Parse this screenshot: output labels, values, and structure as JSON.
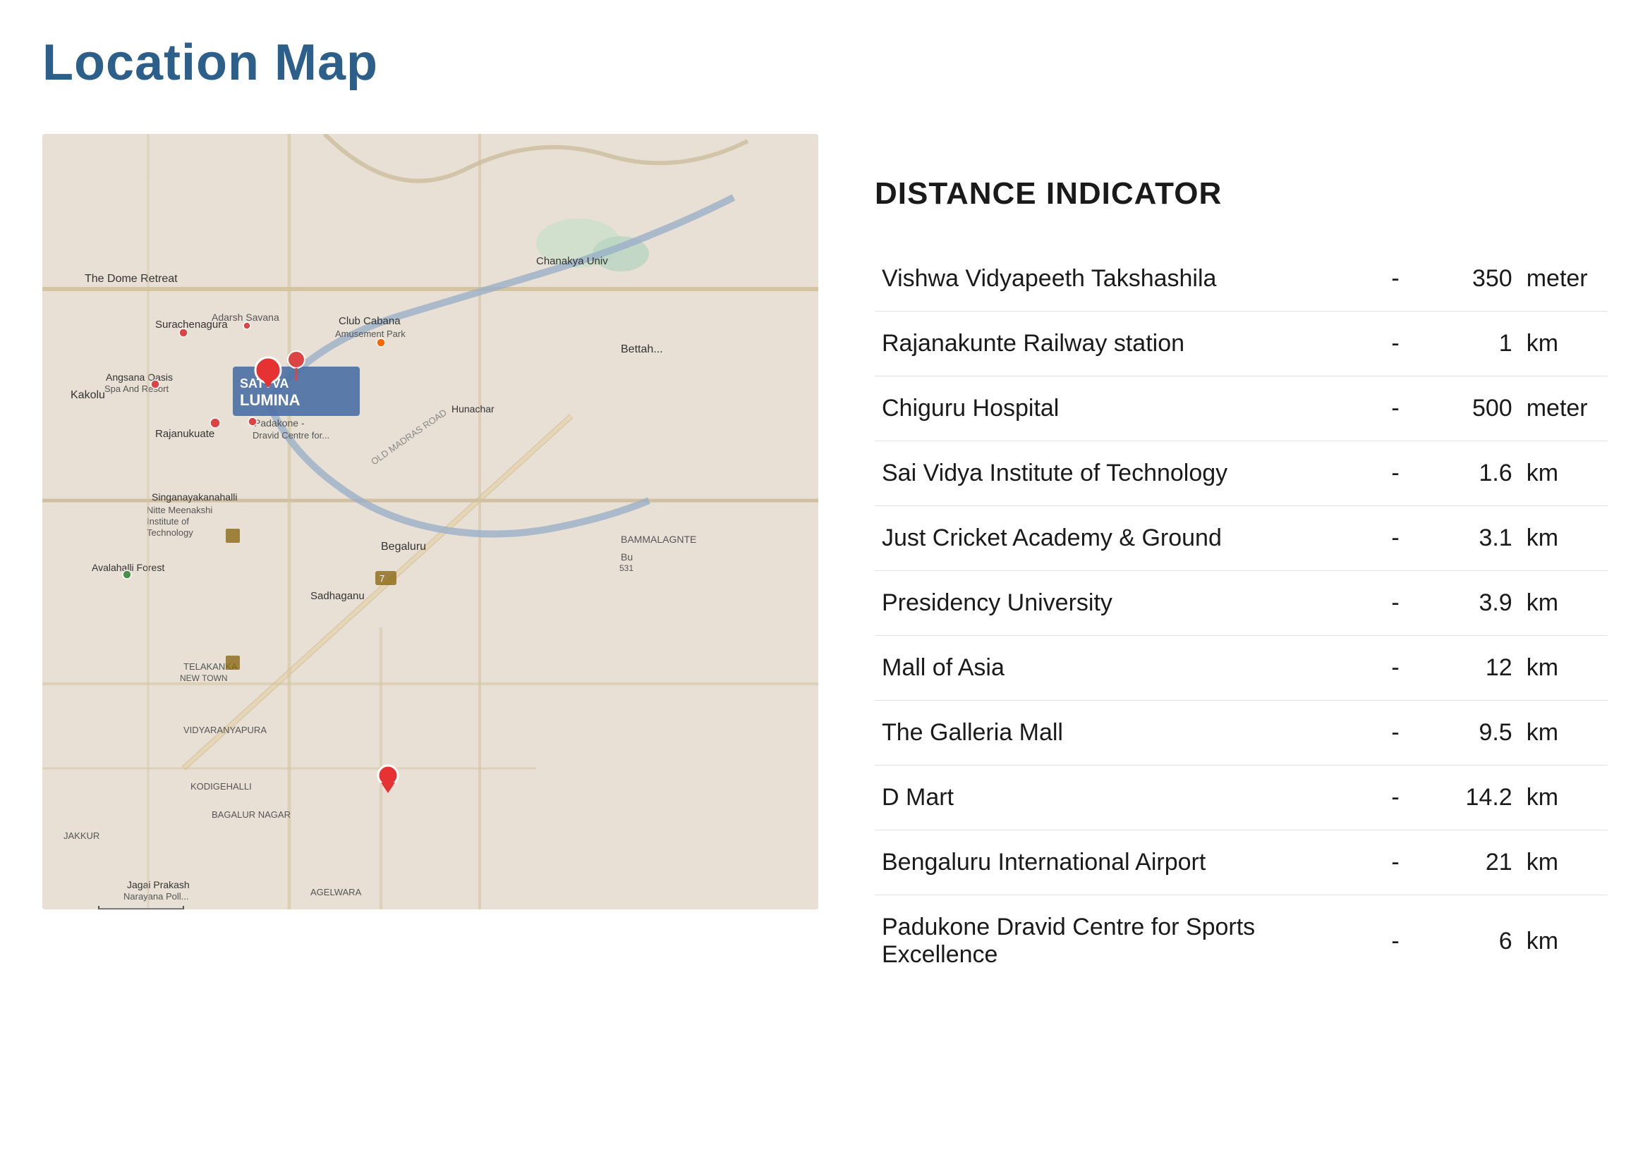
{
  "page": {
    "title": "Location Map"
  },
  "distance_indicator": {
    "heading": "DISTANCE INDICATOR",
    "items": [
      {
        "name": "Vishwa Vidyapeeth Takshashila",
        "dash": "-",
        "value": "350",
        "unit": "meter"
      },
      {
        "name": "Rajanakunte Railway station",
        "dash": "-",
        "value": "1",
        "unit": "km"
      },
      {
        "name": "Chiguru Hospital",
        "dash": "-",
        "value": "500",
        "unit": "meter"
      },
      {
        "name": "Sai Vidya Institute of Technology",
        "dash": "-",
        "value": "1.6",
        "unit": "km"
      },
      {
        "name": "Just Cricket Academy & Ground",
        "dash": "-",
        "value": "3.1",
        "unit": "km"
      },
      {
        "name": "Presidency University",
        "dash": "-",
        "value": "3.9",
        "unit": "km"
      },
      {
        "name": "Mall of Asia",
        "dash": "-",
        "value": "12",
        "unit": "km"
      },
      {
        "name": "The Galleria Mall",
        "dash": "-",
        "value": "9.5",
        "unit": "km"
      },
      {
        "name": "D Mart",
        "dash": "-",
        "value": "14.2",
        "unit": "km"
      },
      {
        "name": "Bengaluru International Airport",
        "dash": "-",
        "value": "21",
        "unit": "km"
      },
      {
        "name": "Padukone Dravid Centre for Sports Excellence",
        "dash": "-",
        "value": "6",
        "unit": "km"
      }
    ]
  },
  "map": {
    "alt": "Location Map showing Sattva Lumina area in Bengaluru"
  }
}
